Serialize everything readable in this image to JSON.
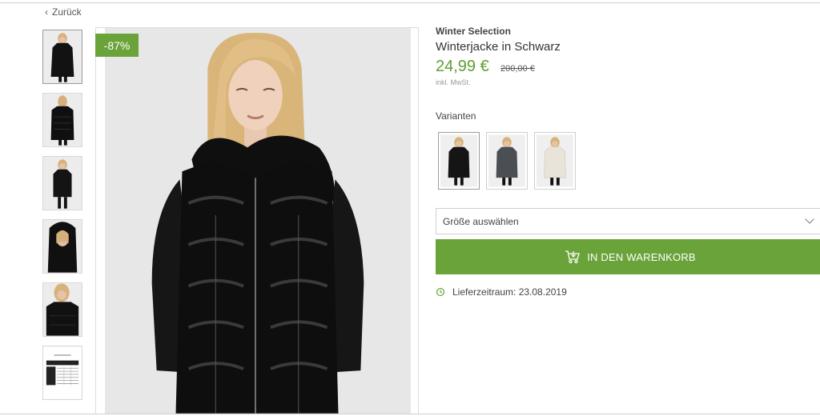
{
  "nav": {
    "back_label": "Zurück"
  },
  "product": {
    "badge": "-87%",
    "brand": "Winter Selection",
    "title": "Winterjacke in Schwarz",
    "price": "24,99 €",
    "old_price": "200,00 €",
    "vat_note": "inkl. MwSt.",
    "variants_label": "Varianten",
    "size_placeholder": "Größe auswählen",
    "add_to_cart_label": "IN DEN WARENKORB",
    "delivery_text": "Lieferzeitraum: 23.08.2019"
  },
  "thumbnails": [
    {
      "name": "front",
      "icon": "product-photo"
    },
    {
      "name": "back",
      "icon": "product-photo"
    },
    {
      "name": "side",
      "icon": "product-photo"
    },
    {
      "name": "hood",
      "icon": "product-photo"
    },
    {
      "name": "detail",
      "icon": "product-photo"
    },
    {
      "name": "size-chart",
      "icon": "size-chart"
    }
  ],
  "variants": [
    {
      "name": "black",
      "color": "#151515"
    },
    {
      "name": "grey",
      "color": "#4b4e53"
    },
    {
      "name": "cream",
      "color": "#e9e3d9"
    }
  ],
  "colors": {
    "accent_green": "#6aa33a",
    "price_green": "#5f9e2f"
  }
}
